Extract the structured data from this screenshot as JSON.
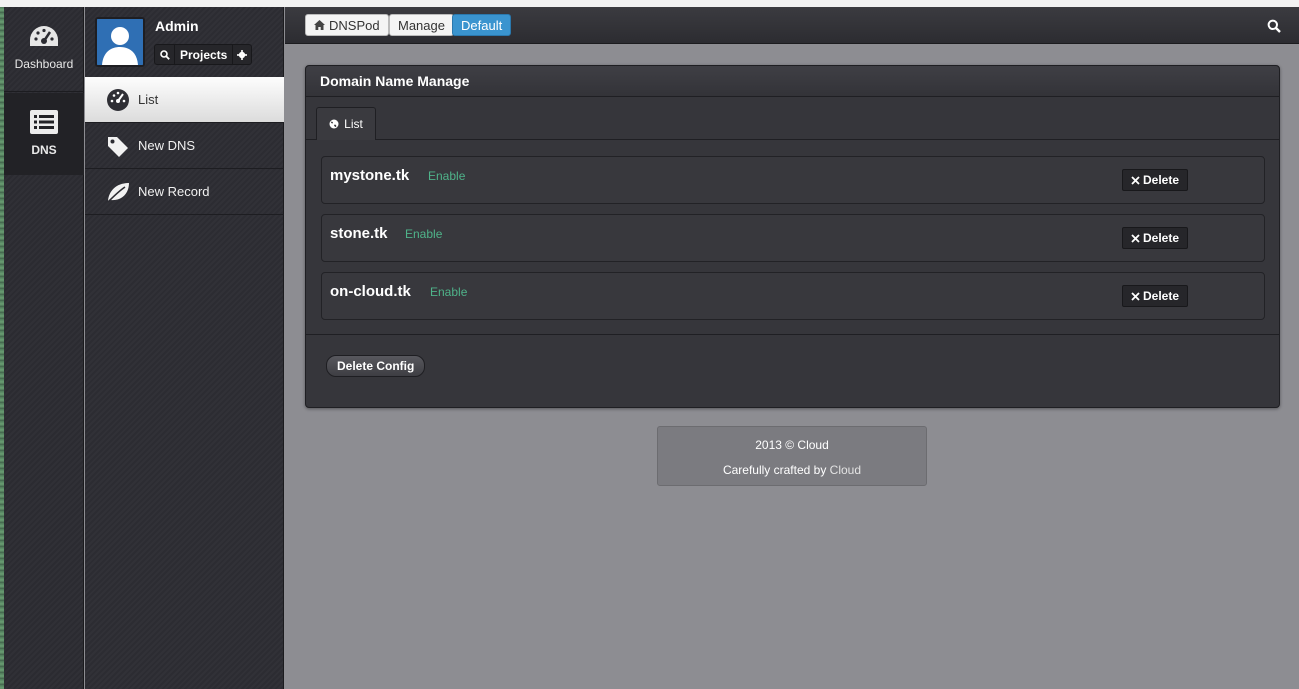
{
  "rail": {
    "items": [
      {
        "label": "Dashboard",
        "icon": "dashboard-gauge-icon"
      },
      {
        "label": "DNS",
        "icon": "list-icon",
        "active": true
      }
    ]
  },
  "profile": {
    "name": "Admin",
    "projects_label": "Projects"
  },
  "menu": {
    "items": [
      {
        "label": "List",
        "icon": "gauge-icon",
        "active": true
      },
      {
        "label": "New DNS",
        "icon": "tag-icon"
      },
      {
        "label": "New Record",
        "icon": "leaf-icon"
      }
    ]
  },
  "breadcrumb": {
    "home": "DNSPod",
    "manage": "Manage",
    "default": "Default"
  },
  "panel": {
    "title": "Domain Name Manage",
    "tab": "List",
    "delete_config": "Delete Config"
  },
  "domains": [
    {
      "name": "mystone.tk",
      "status": "Enable",
      "action": "Delete"
    },
    {
      "name": "stone.tk",
      "status": "Enable",
      "action": "Delete"
    },
    {
      "name": "on-cloud.tk",
      "status": "Enable",
      "action": "Delete"
    }
  ],
  "footer": {
    "copyright": "2013 © Cloud",
    "crafted_prefix": "Carefully crafted by ",
    "crafted_brand": "Cloud"
  },
  "colors": {
    "accent": "#3a94cf",
    "status_enable": "#4fb38a"
  }
}
